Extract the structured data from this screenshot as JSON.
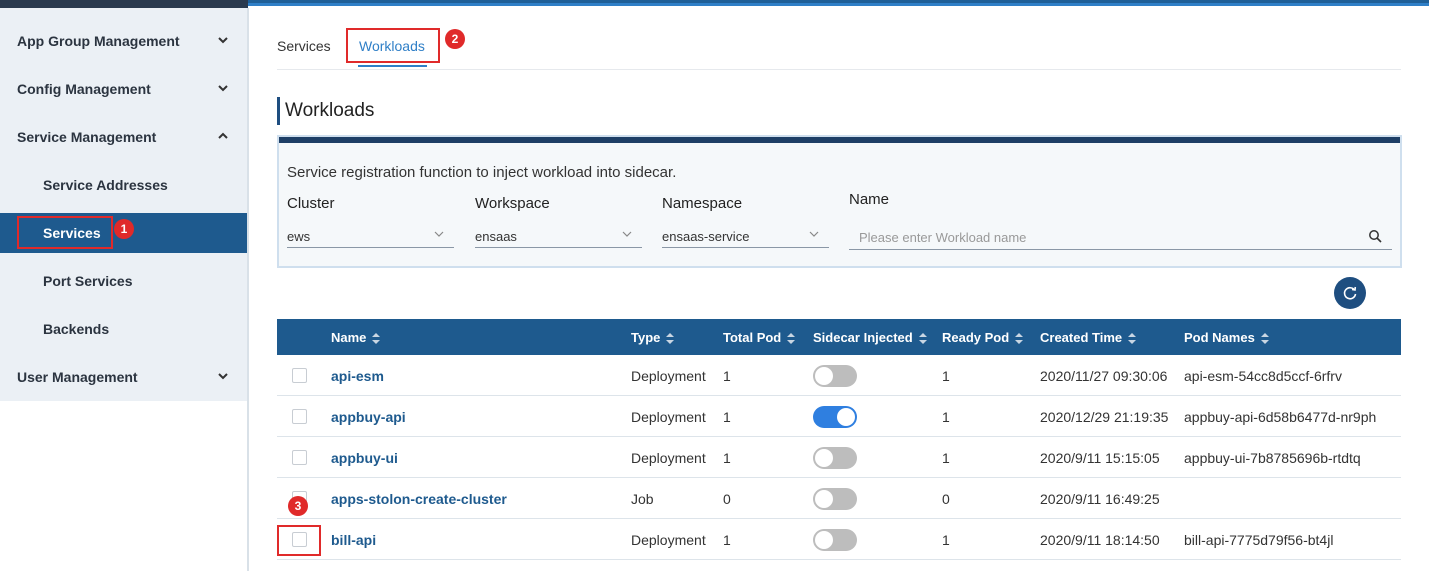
{
  "sidebar": {
    "items": [
      {
        "label": "App Group Management",
        "expanded": false
      },
      {
        "label": "Config Management",
        "expanded": false
      },
      {
        "label": "Service Management",
        "expanded": true
      },
      {
        "label": "Service Addresses"
      },
      {
        "label": "Services",
        "active": true
      },
      {
        "label": "Port Services"
      },
      {
        "label": "Backends"
      },
      {
        "label": "User Management",
        "expanded": false
      }
    ]
  },
  "annotations": {
    "badge1": "1",
    "badge2": "2",
    "badge3": "3",
    "highlight_color": "#e02a2a"
  },
  "tabs": [
    {
      "label": "Services",
      "active": false
    },
    {
      "label": "Workloads",
      "active": true
    }
  ],
  "section_title": "Workloads",
  "filter": {
    "description": "Service registration function to inject workload into sidecar.",
    "cluster": {
      "label": "Cluster",
      "value": "ews"
    },
    "workspace": {
      "label": "Workspace",
      "value": "ensaas"
    },
    "namespace": {
      "label": "Namespace",
      "value": "ensaas-service"
    },
    "name": {
      "label": "Name",
      "placeholder": "Please enter Workload name"
    }
  },
  "table": {
    "columns": [
      "Name",
      "Type",
      "Total Pod",
      "Sidecar Injected",
      "Ready Pod",
      "Created Time",
      "Pod Names"
    ],
    "rows": [
      {
        "name": "api-esm",
        "type": "Deployment",
        "total_pod": "1",
        "sidecar": false,
        "ready_pod": "1",
        "created": "2020/11/27 09:30:06",
        "pod_names": "api-esm-54cc8d5ccf-6rfrv"
      },
      {
        "name": "appbuy-api",
        "type": "Deployment",
        "total_pod": "1",
        "sidecar": true,
        "ready_pod": "1",
        "created": "2020/12/29 21:19:35",
        "pod_names": "appbuy-api-6d58b6477d-nr9ph"
      },
      {
        "name": "appbuy-ui",
        "type": "Deployment",
        "total_pod": "1",
        "sidecar": false,
        "ready_pod": "1",
        "created": "2020/9/11 15:15:05",
        "pod_names": "appbuy-ui-7b8785696b-rtdtq"
      },
      {
        "name": "apps-stolon-create-cluster",
        "type": "Job",
        "total_pod": "0",
        "sidecar": false,
        "ready_pod": "0",
        "created": "2020/9/11 16:49:25",
        "pod_names": ""
      },
      {
        "name": "bill-api",
        "type": "Deployment",
        "total_pod": "1",
        "sidecar": false,
        "ready_pod": "1",
        "created": "2020/9/11 18:14:50",
        "pod_names": "bill-api-7775d79f56-bt4jl"
      }
    ]
  },
  "colors": {
    "primary": "#1e5a8e",
    "accent": "#2f7fc7",
    "toggle_on": "#2f7fe0",
    "toggle_off": "#bdbdbd"
  }
}
